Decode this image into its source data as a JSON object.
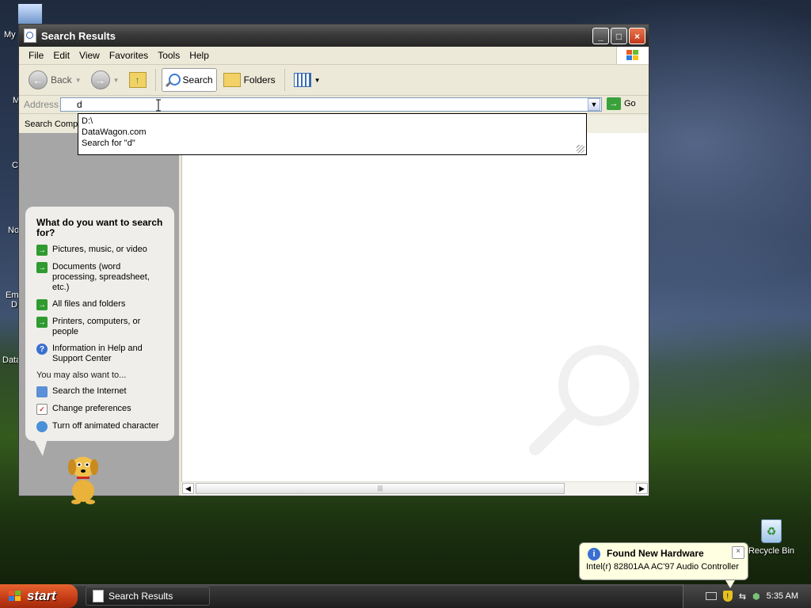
{
  "desktop": {
    "icons": [
      "My",
      "M",
      "C",
      "No",
      "Em",
      "D",
      "Data"
    ],
    "recycle_bin": "Recycle Bin"
  },
  "window": {
    "title": "Search Results",
    "buttons": {
      "minimize": "_",
      "maximize": "□",
      "close": "×"
    }
  },
  "menu": [
    "File",
    "Edit",
    "View",
    "Favorites",
    "Tools",
    "Help"
  ],
  "toolbar": {
    "back": "Back",
    "search": "Search",
    "folders": "Folders"
  },
  "address": {
    "label": "Address",
    "value": "d",
    "go": "Go",
    "suggestions": [
      "D:\\",
      "DataWagon.com",
      "Search for \"d\""
    ]
  },
  "search_companion": {
    "label": "Search Compa",
    "question": "What do you want to search for?",
    "options": [
      "Pictures, music, or video",
      "Documents (word processing, spreadsheet, etc.)",
      "All files and folders",
      "Printers, computers, or people",
      "Information in Help and Support Center"
    ],
    "also_label": "You may also want to...",
    "also_options": [
      "Search the Internet",
      "Change preferences",
      "Turn off animated character"
    ]
  },
  "taskbar": {
    "start": "start",
    "task": "Search Results",
    "clock": "5:35 AM"
  },
  "balloon": {
    "title": "Found New Hardware",
    "message": "Intel(r) 82801AA AC'97 Audio Controller"
  },
  "colors": {
    "accent_green": "#2f9a2f",
    "start_orange": "#c33b16",
    "balloon_bg": "#ffffe1"
  }
}
